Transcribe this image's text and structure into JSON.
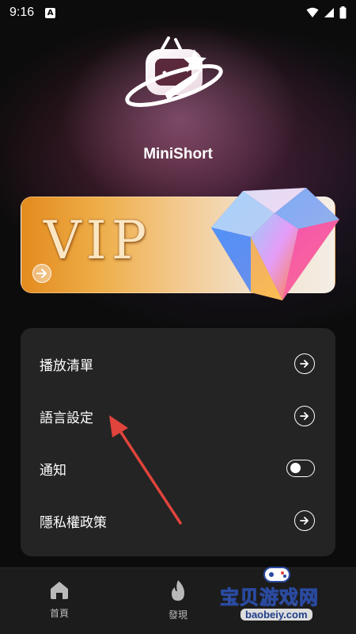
{
  "status_bar": {
    "time": "9:16",
    "notification_letter": "A"
  },
  "app": {
    "name": "MiniShort"
  },
  "vip_banner": {
    "label": "VIP"
  },
  "menu": {
    "items": [
      {
        "label": "播放清單",
        "control": "arrow"
      },
      {
        "label": "語言設定",
        "control": "arrow"
      },
      {
        "label": "通知",
        "control": "toggle",
        "toggle_on": false
      },
      {
        "label": "隱私權政策",
        "control": "arrow"
      }
    ]
  },
  "bottom_nav": {
    "items": [
      {
        "label": "首頁",
        "icon": "home-icon"
      },
      {
        "label": "發現",
        "icon": "flame-icon"
      }
    ]
  },
  "watermark": {
    "text": "宝贝游戏网",
    "url": "baobeiy.com"
  },
  "colors": {
    "background": "#0c0c0c",
    "card": "#242424",
    "vip_gold": "#eeae49",
    "annotation_red": "#e0443c",
    "watermark_yellow": "#ffd21f"
  }
}
